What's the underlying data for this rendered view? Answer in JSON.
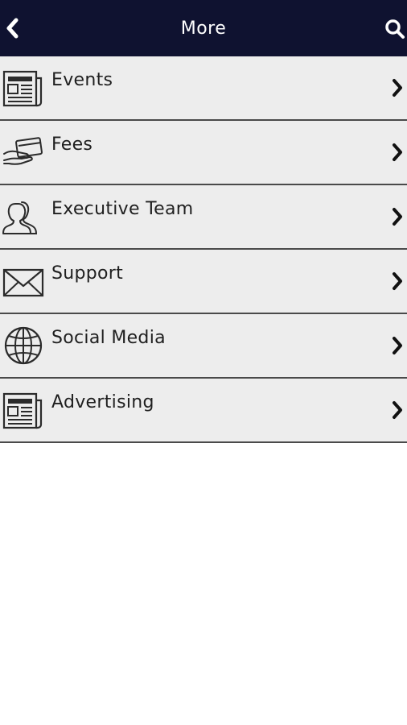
{
  "header": {
    "title": "More",
    "back_icon": "chevron-left-icon",
    "search_icon": "search-icon"
  },
  "menu": [
    {
      "label": "Events",
      "icon": "newspaper-icon"
    },
    {
      "label": "Fees",
      "icon": "card-hand-icon"
    },
    {
      "label": "Executive Team",
      "icon": "people-icon"
    },
    {
      "label": "Support",
      "icon": "envelope-icon"
    },
    {
      "label": "Social Media",
      "icon": "globe-icon"
    },
    {
      "label": "Advertising",
      "icon": "newspaper-icon"
    }
  ],
  "colors": {
    "header_bg": "#0f1230",
    "row_bg": "#ededed",
    "divider": "#4a4a4a",
    "text": "#1f1f1f"
  }
}
